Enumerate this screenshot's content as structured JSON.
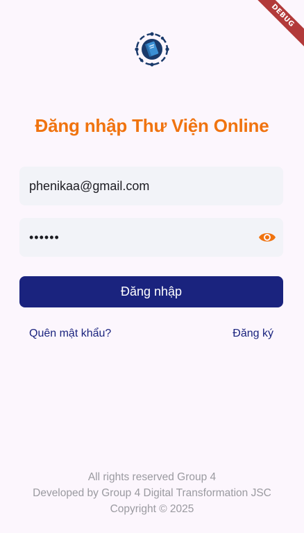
{
  "debug_banner": "DEBUG",
  "logo": {
    "icon": "book-globe-icon"
  },
  "title": "Đăng nhập Thư Viện Online",
  "form": {
    "email_value": "phenikaa@gmail.com",
    "password_value": "••••••",
    "password_toggle_icon": "eye-icon",
    "login_label": "Đăng nhập"
  },
  "links": {
    "forgot_password": "Quên mật khẩu?",
    "register": "Đăng ký"
  },
  "footer": {
    "line1": "All rights reserved Group 4",
    "line2": "Developed by Group 4 Digital Transformation JSC",
    "line3": "Copyright © 2025"
  },
  "colors": {
    "background": "#fcf6fd",
    "title": "#f0730f",
    "primary": "#1a237e",
    "field_bg": "#f2f3f8",
    "footer_text": "#9a9aa0"
  }
}
